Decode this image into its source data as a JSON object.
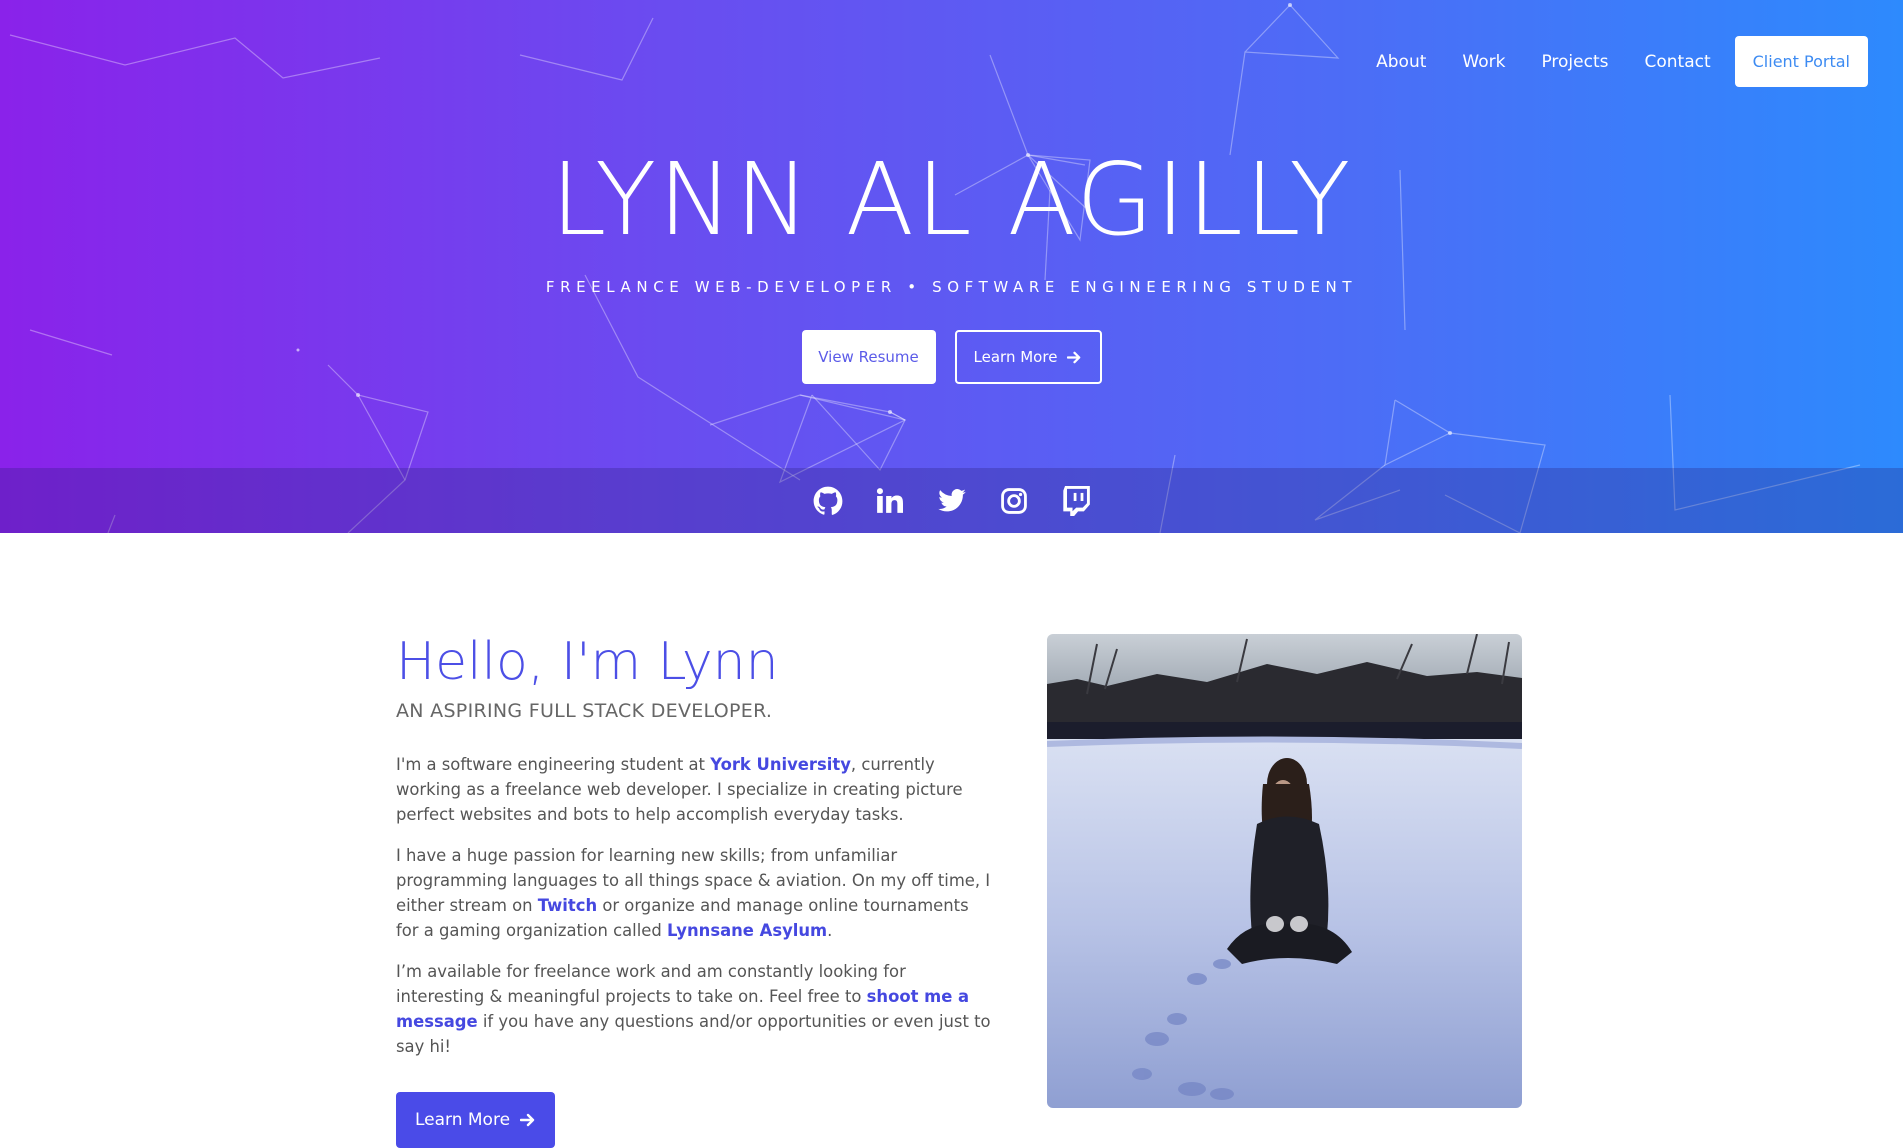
{
  "nav": {
    "items": [
      "About",
      "Work",
      "Projects",
      "Contact"
    ],
    "portal_label": "Client Portal"
  },
  "hero": {
    "title": "LYNN AL AGILLY",
    "subtitle": "FREELANCE WEB-DEVELOPER • SOFTWARE ENGINEERING STUDENT",
    "resume_label": "View Resume",
    "learn_label": "Learn More"
  },
  "social": {
    "icons": [
      "github-icon",
      "linkedin-icon",
      "twitter-icon",
      "instagram-icon",
      "twitch-icon"
    ]
  },
  "about": {
    "heading": "Hello, I'm Lynn",
    "tagline": "AN ASPIRING FULL STACK DEVELOPER.",
    "p1_before": "I'm a software engineering student at ",
    "p1_link": "York University",
    "p1_after": ", currently working as a freelance web developer. I specialize in creating picture perfect websites and bots to help accomplish everyday tasks.",
    "p2_before": "I have a huge passion for learning new skills; from unfamiliar programming languages to all things space & aviation. On my off time, I either stream on ",
    "p2_link1": "Twitch",
    "p2_mid": " or organize and manage online tournaments for a gaming organization called ",
    "p2_link2": "Lynnsane Asylum",
    "p2_after": ".",
    "p3_before": "I’m available for freelance work and am constantly looking for interesting & meaningful projects to take on. Feel free to ",
    "p3_link": "shoot me a message",
    "p3_after": " if you have any questions and/or opportunities or even just to say hi!",
    "button_label": "Learn More"
  },
  "colors": {
    "gradient_start": "#8a22ea",
    "gradient_end": "#2d8afd",
    "accent": "#4a4be8",
    "portal_text": "#3d8bf2"
  }
}
